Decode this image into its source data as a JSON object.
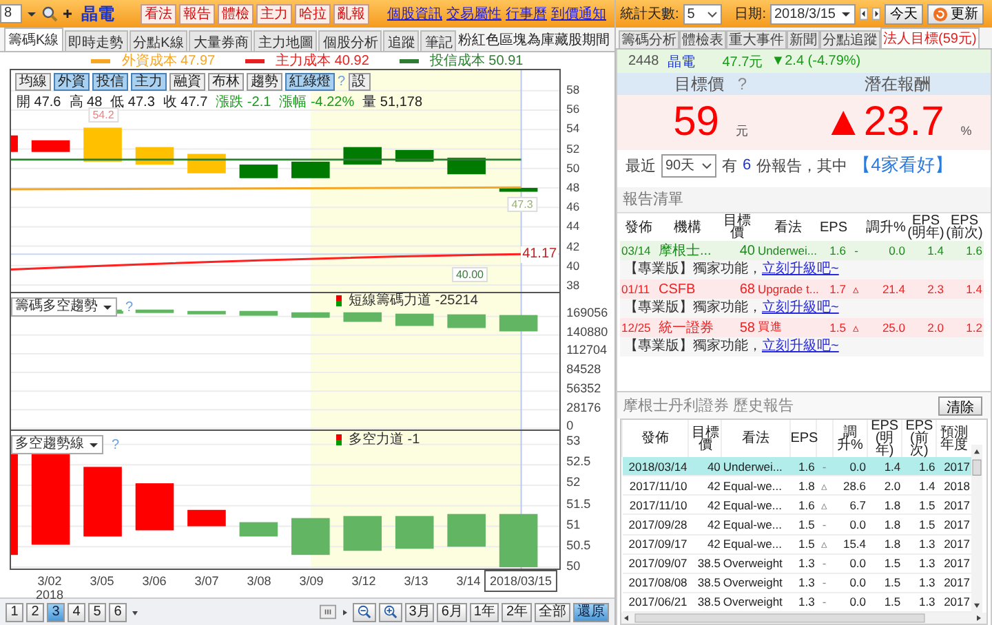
{
  "toolbar": {
    "code_value": "8",
    "stock_name": "晶電",
    "buttons": [
      "看法",
      "報告",
      "體檢",
      "主力",
      "哈拉",
      "亂報"
    ],
    "links": [
      "個股資訊",
      "交易屬性",
      "行事曆",
      "到價通知"
    ]
  },
  "left_tabs": [
    {
      "label": "籌碼K線",
      "selected": true
    },
    {
      "label": "即時走勢",
      "selected": false
    },
    {
      "label": "分點K線",
      "selected": false
    },
    {
      "label": "大量券商",
      "selected": false
    },
    {
      "label": "主力地圖",
      "selected": false
    },
    {
      "label": "個股分析",
      "selected": false
    },
    {
      "label": "追蹤",
      "selected": false
    },
    {
      "label": "筆記",
      "selected": false
    }
  ],
  "note": "粉紅色區塊為庫藏股期間",
  "legend": [
    {
      "label": "外資成本 47.97",
      "color": "#f5a623"
    },
    {
      "label": "主力成本 40.92",
      "color": "#e82020"
    },
    {
      "label": "投信成本 50.91",
      "color": "#2e7d32"
    }
  ],
  "chart_toolbar": [
    {
      "label": "均線",
      "selected": false
    },
    {
      "label": "外資",
      "selected": true
    },
    {
      "label": "投信",
      "selected": true
    },
    {
      "label": "主力",
      "selected": true
    },
    {
      "label": "融資",
      "selected": false
    },
    {
      "label": "布林",
      "selected": false
    },
    {
      "label": "趨勢",
      "selected": false
    },
    {
      "label": "紅綠燈",
      "selected": true
    }
  ],
  "chart_help": "?",
  "chart_settings": "設",
  "quote": [
    {
      "label": "開",
      "value": "47.6",
      "kind": "plain"
    },
    {
      "label": "高",
      "value": "48",
      "kind": "plain"
    },
    {
      "label": "低",
      "value": "47.3",
      "kind": "plain"
    },
    {
      "label": "收",
      "value": "47.7",
      "kind": "plain"
    },
    {
      "label": "漲跌",
      "value": "-2.1",
      "kind": "down"
    },
    {
      "label": "漲幅",
      "value": "-4.22%",
      "kind": "down"
    },
    {
      "label": "量",
      "value": "51,178",
      "kind": "plain"
    }
  ],
  "price_axis": [
    "58",
    "56",
    "54",
    "52",
    "50",
    "48",
    "46",
    "44",
    "42",
    "40",
    "38"
  ],
  "price_now": "41.17",
  "price_tags": [
    "54.2",
    "47.3",
    "40.00"
  ],
  "panel2": {
    "selector": "籌碼多空趨勢",
    "help": "?",
    "indicator": "短線籌碼力道 -25214",
    "axis": [
      "169056",
      "140880",
      "112704",
      "84528",
      "56352",
      "28176",
      "0"
    ]
  },
  "panel3": {
    "selector": "多空趨勢線",
    "help": "?",
    "indicator": "多空力道 -1",
    "axis": [
      "53",
      "52.5",
      "52",
      "51.5",
      "51",
      "50.5",
      "50"
    ]
  },
  "dates": [
    {
      "label": "3/02",
      "sub": "2018",
      "selected": false
    },
    {
      "label": "3/05",
      "selected": false
    },
    {
      "label": "3/06",
      "selected": false
    },
    {
      "label": "3/07",
      "selected": false
    },
    {
      "label": "3/08",
      "selected": false
    },
    {
      "label": "3/09",
      "selected": false
    },
    {
      "label": "3/12",
      "selected": false
    },
    {
      "label": "3/13",
      "selected": false
    },
    {
      "label": "3/14",
      "selected": false
    },
    {
      "label": "2018/03/15",
      "selected": true
    }
  ],
  "pages": [
    {
      "label": "1",
      "selected": false
    },
    {
      "label": "2",
      "selected": false
    },
    {
      "label": "3",
      "selected": true
    },
    {
      "label": "4",
      "selected": false
    },
    {
      "label": "5",
      "selected": false
    },
    {
      "label": "6",
      "selected": false
    }
  ],
  "range_buttons": [
    {
      "label": "3月",
      "selected": false
    },
    {
      "label": "6月",
      "selected": false
    },
    {
      "label": "1年",
      "selected": false
    },
    {
      "label": "2年",
      "selected": false
    },
    {
      "label": "全部",
      "selected": false
    },
    {
      "label": "還原",
      "selected": true
    }
  ],
  "right_toolbar": {
    "days_label": "統計天數:",
    "days_value": "5",
    "date_label": "日期:",
    "date_value": "2018/3/15",
    "today": "今天",
    "refresh": "更新"
  },
  "right_tabs": [
    {
      "label": "籌碼分析",
      "selected": false
    },
    {
      "label": "體檢表",
      "selected": false
    },
    {
      "label": "重大事件",
      "selected": false
    },
    {
      "label": "新聞",
      "selected": false
    },
    {
      "label": "分點追蹤",
      "selected": false
    },
    {
      "label": "法人目標(59元)",
      "selected": true
    }
  ],
  "stock_info": {
    "code": "2448",
    "name": "晶電",
    "price": "47.7元",
    "change": "▼2.4 (-4.79%)"
  },
  "target": {
    "label": "目標價",
    "help": "?",
    "value": "59",
    "unit": "元"
  },
  "upside": {
    "label": "潛在報酬",
    "value": "▲23.7",
    "unit": "%"
  },
  "summary": {
    "prefix": "最近",
    "period": "90天",
    "mid": "有",
    "count": "6",
    "suffix": "份報告，其中",
    "highlight": "【4家看好】"
  },
  "reports": {
    "title": "報告清單",
    "columns": [
      "發佈",
      "機構",
      "目標價",
      "看法",
      "EPS",
      "",
      "調升%",
      "EPS\n(明年)",
      "EPS\n(前次)"
    ],
    "rows": [
      {
        "kind": "report",
        "color": "#e9f6e6",
        "cells": [
          "03/14",
          "摩根士...",
          "40",
          "Underwei...",
          "1.6",
          "-",
          "0.0",
          "1.4",
          "1.6"
        ]
      },
      {
        "kind": "promo",
        "text": "【專業版】獨家功能，",
        "link": "立刻升級吧~"
      },
      {
        "kind": "report",
        "color": "#fde8ea",
        "cells": [
          "01/11",
          "CSFB",
          "68",
          "Upgrade t...",
          "1.7",
          "▵",
          "21.4",
          "2.3",
          "1.4"
        ]
      },
      {
        "kind": "promo",
        "text": "【專業版】獨家功能，",
        "link": "立刻升級吧~"
      },
      {
        "kind": "report",
        "color": "#fde8ea",
        "cells": [
          "12/25",
          "統一證券",
          "58",
          "買進",
          "1.5",
          "▵",
          "25.0",
          "2.0",
          "1.2"
        ]
      },
      {
        "kind": "promo",
        "text": "【專業版】獨家功能，",
        "link": "立刻升級吧~"
      }
    ]
  },
  "history": {
    "title": "摩根士丹利證券 歷史報告",
    "clear": "清除",
    "columns": [
      "發佈",
      "目標價",
      "看法",
      "EPS",
      "",
      "調升%",
      "EPS\n(明年)",
      "EPS\n(前次)",
      "預測年度"
    ],
    "rows": [
      {
        "selected": true,
        "cells": [
          "2018/03/14",
          "40",
          "Underwei...",
          "1.6",
          "-",
          "0.0",
          "1.4",
          "1.6",
          "2017"
        ]
      },
      {
        "selected": false,
        "cells": [
          "2017/11/10",
          "42",
          "Equal-we...",
          "1.8",
          "▵",
          "28.6",
          "2.0",
          "1.4",
          "2018"
        ]
      },
      {
        "selected": false,
        "cells": [
          "2017/11/10",
          "42",
          "Equal-we...",
          "1.6",
          "▵",
          "6.7",
          "1.8",
          "1.5",
          "2017"
        ]
      },
      {
        "selected": false,
        "cells": [
          "2017/09/28",
          "42",
          "Equal-we...",
          "1.5",
          "-",
          "0.0",
          "1.8",
          "1.5",
          "2017"
        ]
      },
      {
        "selected": false,
        "cells": [
          "2017/09/17",
          "42",
          "Equal-we...",
          "1.5",
          "▵",
          "15.4",
          "1.8",
          "1.3",
          "2017"
        ]
      },
      {
        "selected": false,
        "cells": [
          "2017/09/07",
          "38.5",
          "Overweight",
          "1.3",
          "-",
          "0.0",
          "1.5",
          "1.3",
          "2017"
        ]
      },
      {
        "selected": false,
        "cells": [
          "2017/08/08",
          "38.5",
          "Overweight",
          "1.3",
          "-",
          "0.0",
          "1.5",
          "1.3",
          "2017"
        ]
      },
      {
        "selected": false,
        "cells": [
          "2017/06/21",
          "38.5",
          "Overweight",
          "1.3",
          "-",
          "0.0",
          "1.5",
          "1.3",
          "2017"
        ]
      }
    ]
  }
}
